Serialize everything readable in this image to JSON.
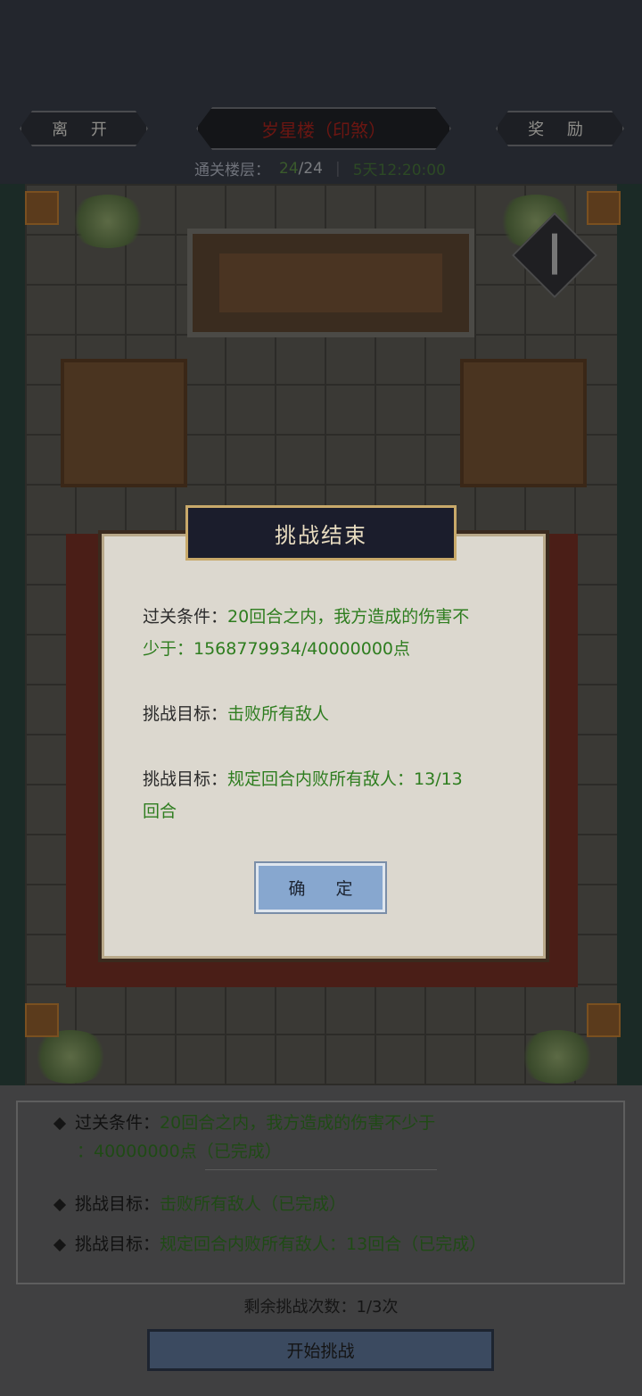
{
  "header": {
    "leave_label": "离 开",
    "stage_title": "岁星楼（印煞）",
    "reward_label": "奖 励",
    "floor_label": "通关楼层：",
    "floor_current": "24",
    "floor_total": "/24",
    "timer": "5天12:20:00"
  },
  "dialog": {
    "title": "挑战结束",
    "cond1_label": "过关条件：",
    "cond1_value_a": "20回合之内，我方造成的伤害不",
    "cond1_value_b": "少于：1568779934/40000000点",
    "goal1_label": "挑战目标：",
    "goal1_value": "击败所有敌人",
    "goal2_label": "挑战目标：",
    "goal2_value_a": "规定回合内败所有敌人：13/13",
    "goal2_value_b": "回合",
    "confirm_label": "确 定"
  },
  "info": {
    "row1_label": "过关条件：",
    "row1_value": "20回合之内，我方造成的伤害不少于",
    "row1_cont": "：40000000点（已完成）",
    "row2_label": "挑战目标：",
    "row2_value": "击败所有敌人（已完成）",
    "row3_label": "挑战目标：",
    "row3_value": "规定回合内败所有敌人：13回合（已完成）"
  },
  "remaining": "剩余挑战次数：1/3次",
  "start_label": "开始挑战",
  "colors": {
    "value_green": "#2e7d1f",
    "dialog_bg": "#dcd8cf",
    "confirm_blue": "#87a7cf"
  }
}
